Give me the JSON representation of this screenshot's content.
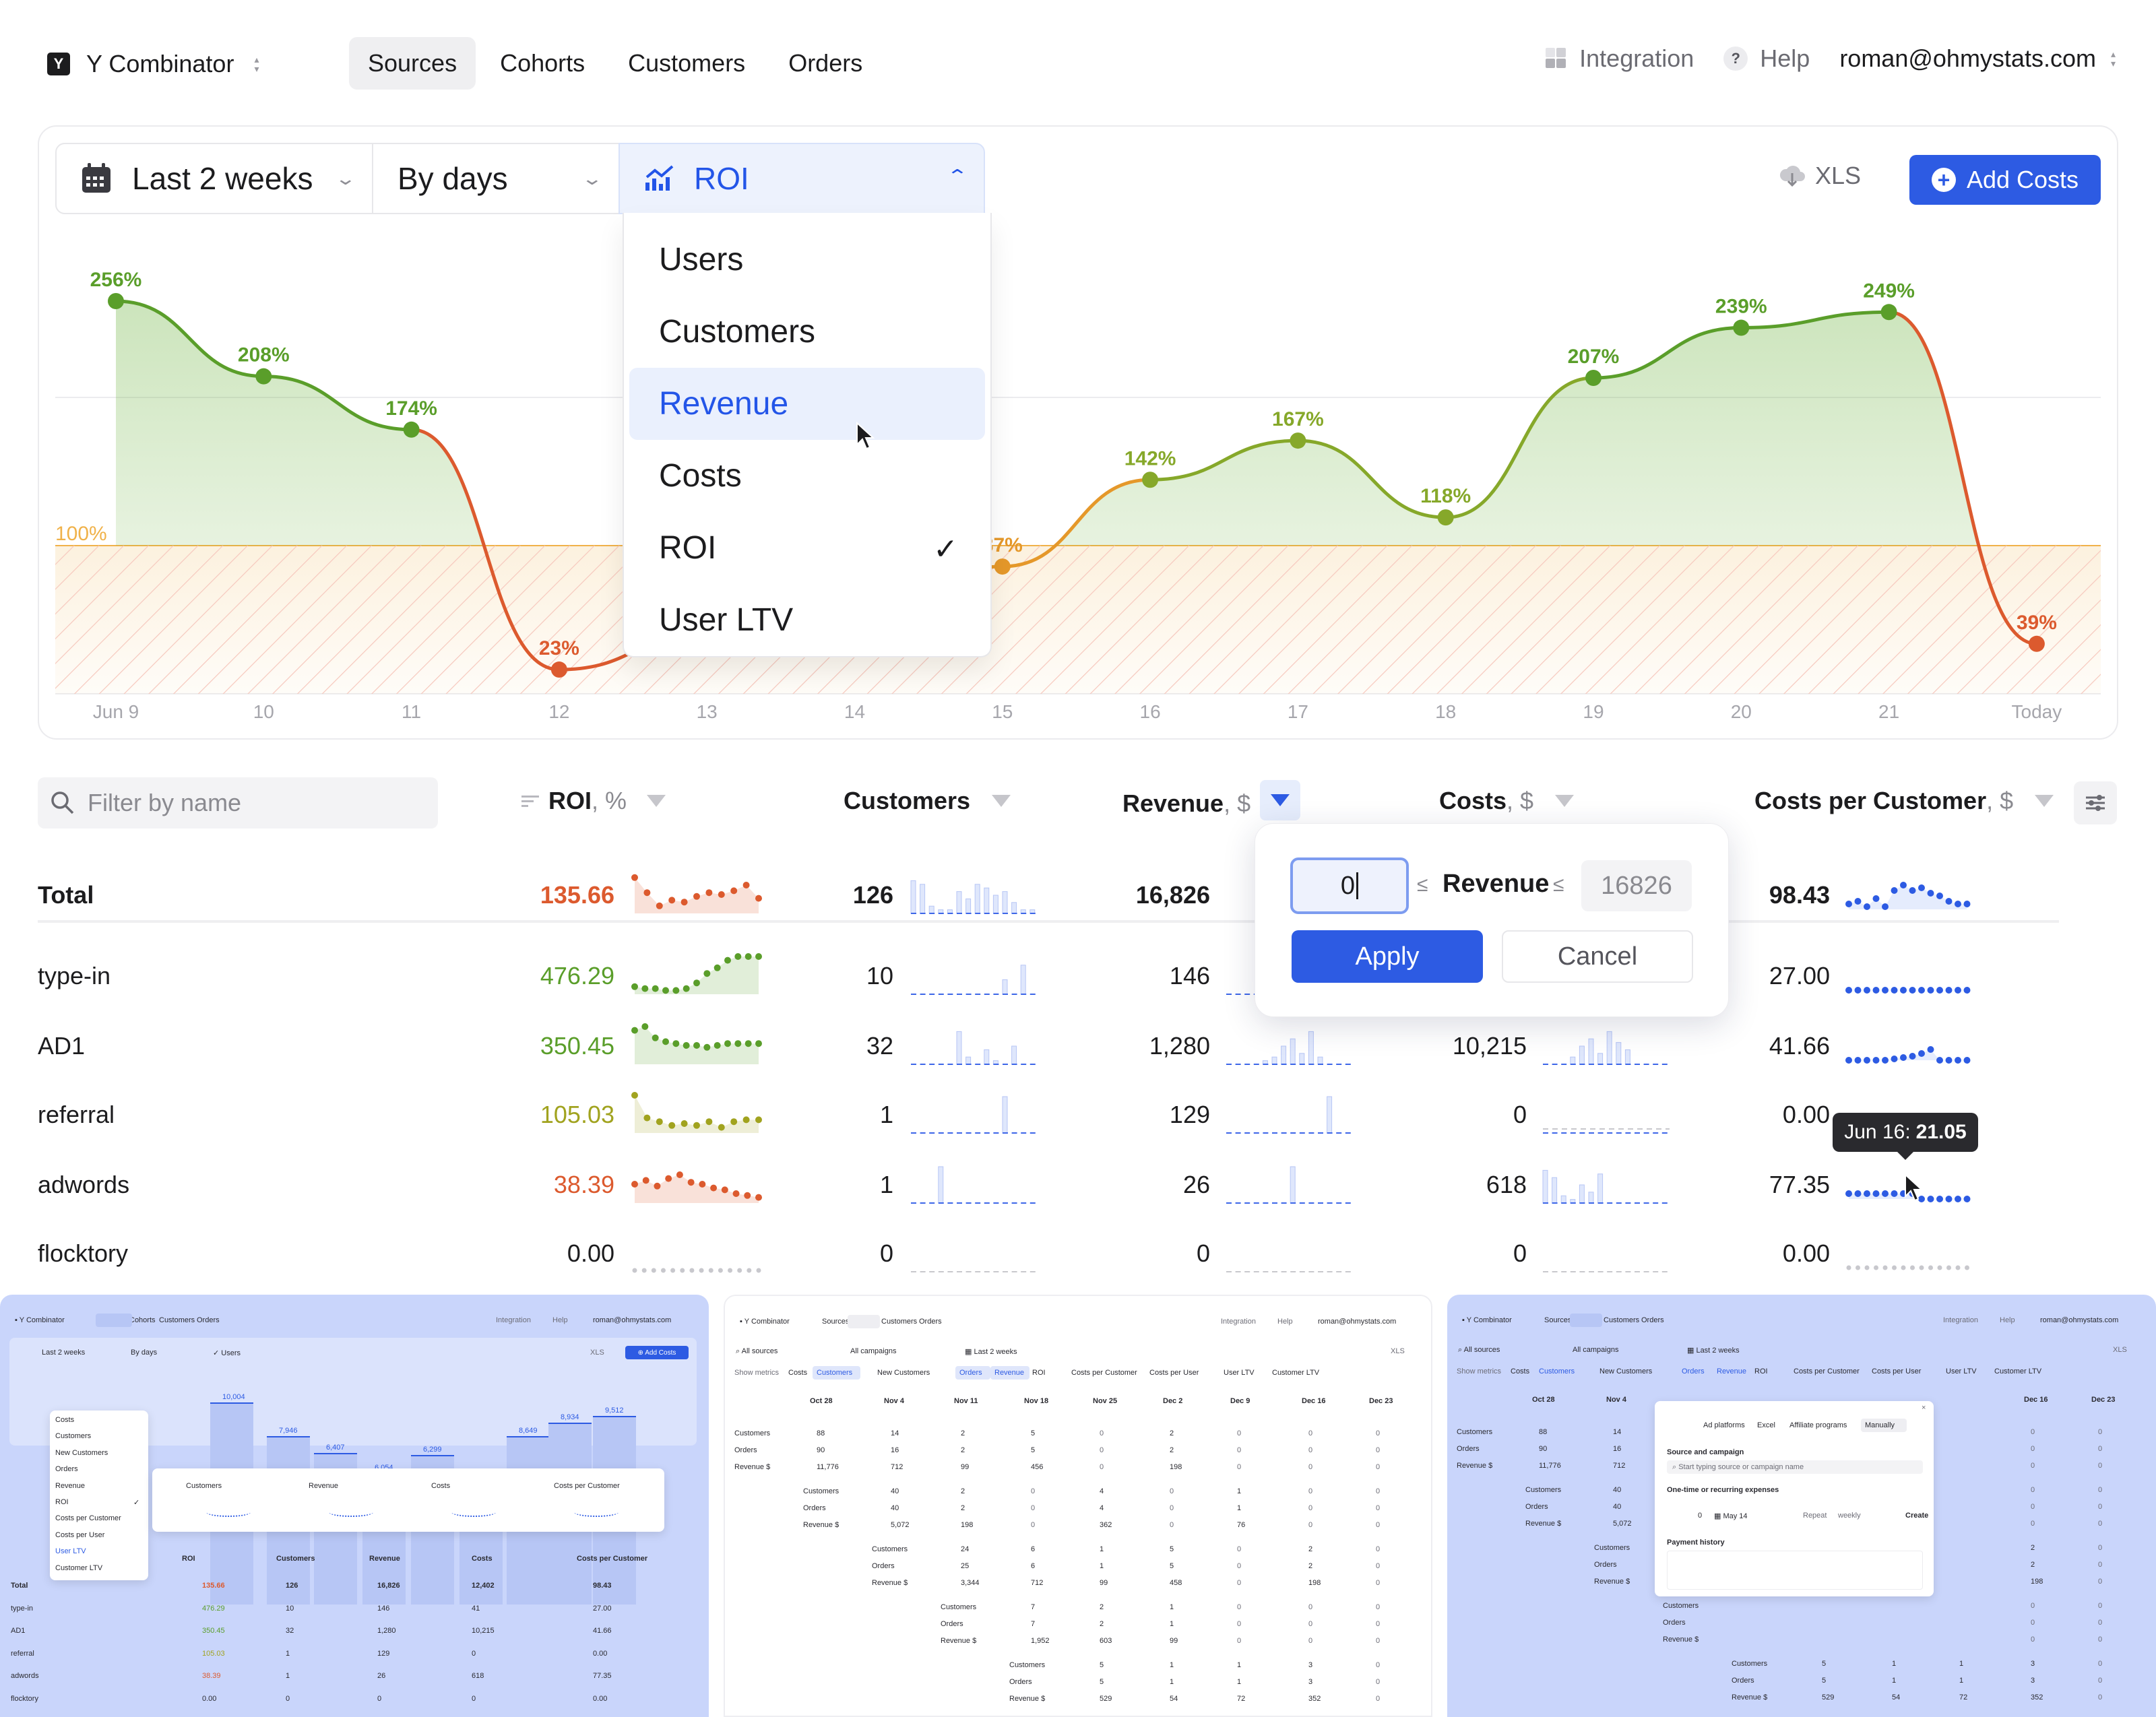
{
  "app": {
    "org_name": "Y Combinator",
    "logo_letter": "Y",
    "nav_tabs": [
      "Sources",
      "Cohorts",
      "Customers",
      "Orders"
    ],
    "active_tab": "Sources",
    "integration_label": "Integration",
    "help_label": "Help",
    "user_email": "roman@ohmystats.com"
  },
  "controls": {
    "period": "Last 2 weeks",
    "grouping": "By days",
    "metric": "ROI",
    "xls_label": "XLS",
    "add_costs_label": "Add Costs"
  },
  "metric_dropdown": {
    "options": [
      "Users",
      "Customers",
      "Revenue",
      "Costs",
      "ROI",
      "User LTV"
    ],
    "hovered": "Revenue",
    "selected": "ROI",
    "check_glyph": "✓"
  },
  "colors": {
    "accent": "#2d5be3",
    "green": "#5a9e2a",
    "olive": "#a1a31f",
    "orange": "#e5982a",
    "red": "#dc5a2e",
    "threshold": "#f0b24a"
  },
  "chart_data": {
    "type": "line",
    "x": [
      "Jun 9",
      "10",
      "11",
      "12",
      "13",
      "14",
      "15",
      "16",
      "17",
      "18",
      "19",
      "20",
      "21",
      "Today"
    ],
    "series": [
      {
        "values": [
          256,
          208,
          174,
          23,
          null,
          null,
          87,
          142,
          167,
          118,
          207,
          239,
          249,
          39
        ],
        "labels": [
          "256%",
          "208%",
          "174%",
          "23%",
          "",
          "",
          "87%",
          "142%",
          "167%",
          "118%",
          "207%",
          "239%",
          "249%",
          "39%"
        ]
      }
    ],
    "threshold": 100,
    "threshold_label": "100%",
    "ylim": [
      0,
      300
    ],
    "grid": true,
    "fill_below_threshold": "hatched"
  },
  "table": {
    "filter_placeholder": "Filter by name",
    "columns": [
      {
        "label": "ROI",
        "unit": ", %"
      },
      {
        "label": "Customers",
        "unit": ""
      },
      {
        "label": "Revenue",
        "unit": ", $"
      },
      {
        "label": "Costs",
        "unit": ", $"
      },
      {
        "label": "Costs per Customer",
        "unit": ", $"
      }
    ],
    "rows": [
      {
        "name": "Total",
        "roi": "135.66",
        "customers": "126",
        "revenue": "16,826",
        "costs": "",
        "cpc": "98.43",
        "roi_color": "red"
      },
      {
        "name": "type-in",
        "roi": "476.29",
        "customers": "10",
        "revenue": "146",
        "costs": "",
        "cpc": "27.00",
        "roi_color": "green"
      },
      {
        "name": "AD1",
        "roi": "350.45",
        "customers": "32",
        "revenue": "1,280",
        "costs": "10,215",
        "cpc": "41.66",
        "roi_color": "green"
      },
      {
        "name": "referral",
        "roi": "105.03",
        "customers": "1",
        "revenue": "129",
        "costs": "0",
        "cpc": "0.00",
        "roi_color": "olive"
      },
      {
        "name": "adwords",
        "roi": "38.39",
        "customers": "1",
        "revenue": "26",
        "costs": "618",
        "cpc": "77.35",
        "roi_color": "red"
      },
      {
        "name": "flocktory",
        "roi": "0.00",
        "customers": "0",
        "revenue": "0",
        "costs": "0",
        "cpc": "0.00",
        "roi_color": "gray"
      }
    ]
  },
  "revenue_filter": {
    "min_value": "0",
    "label": "Revenue",
    "le_glyph": "≤",
    "max_placeholder": "16826",
    "apply_label": "Apply",
    "cancel_label": "Cancel"
  },
  "tooltip": {
    "date": "Jun 16:",
    "value": "21.05"
  },
  "thumbnails": {
    "t1": {
      "brand": "Y Combinator",
      "tabs": [
        "Sources",
        "Cohorts",
        "Customers",
        "Orders"
      ],
      "right": [
        "Integration",
        "Help",
        "roman@ohmystats.com"
      ],
      "period": "Last 2 weeks",
      "grouping": "By days",
      "metric": "Users",
      "xls": "XLS",
      "add": "Add Costs",
      "menu": [
        "Costs",
        "Customers",
        "New Customers",
        "Orders",
        "Revenue",
        "ROI",
        "Costs per Customer",
        "Costs per User",
        "User LTV",
        "Customer LTV"
      ],
      "bar_labels": [
        "10,004",
        "7,946",
        "6,407",
        "6,054",
        "6,299",
        "5,338",
        "8,649",
        "8,934",
        "9,512"
      ],
      "cards": [
        "Customers",
        "Revenue",
        "Costs",
        "Costs per Customer"
      ],
      "headers": [
        "ROI",
        "Customers",
        "Revenue",
        "Costs",
        "Costs per Customer"
      ],
      "rows": [
        [
          "Total",
          "135.66",
          "126",
          "16,826",
          "12,402",
          "98.43"
        ],
        [
          "type-in",
          "476.29",
          "10",
          "146",
          "41",
          "27.00"
        ],
        [
          "AD1",
          "350.45",
          "32",
          "1,280",
          "10,215",
          "41.66"
        ],
        [
          "referral",
          "105.03",
          "1",
          "129",
          "0",
          "0.00"
        ],
        [
          "adwords",
          "38.39",
          "1",
          "26",
          "618",
          "77.35"
        ],
        [
          "flocktory",
          "0.00",
          "0",
          "0",
          "0",
          "0.00"
        ]
      ]
    },
    "t2": {
      "brand": "Y Combinator",
      "tabs": [
        "Sources",
        "Cohorts",
        "Customers",
        "Orders"
      ],
      "right": [
        "Integration",
        "Help",
        "roman@ohmystats.com"
      ],
      "filters": [
        "All sources",
        "All campaigns",
        "Last 2 weeks"
      ],
      "xls": "XLS",
      "show_metrics": "Show metrics",
      "metric_chips": [
        "Costs",
        "Customers",
        "New Customers",
        "Orders",
        "Revenue",
        "ROI",
        "Costs per Customer",
        "Costs per User",
        "User LTV",
        "Customer LTV"
      ],
      "dates": [
        "Oct 28",
        "Nov 4",
        "Nov 11",
        "Nov 18",
        "Nov 25",
        "Dec 2",
        "Dec 9",
        "Dec 16",
        "Dec 23"
      ],
      "blocks": [
        {
          "labels": [
            "Customers",
            "Orders",
            "Revenue"
          ],
          "values": [
            [
              "88",
              "14",
              "2",
              "5",
              "0",
              "2",
              "0",
              "0",
              "0"
            ],
            [
              "90",
              "16",
              "2",
              "5",
              "0",
              "2",
              "0",
              "0",
              "0"
            ],
            [
              "11,776",
              "712",
              "99",
              "456",
              "0",
              "198",
              "0",
              "0",
              "0"
            ]
          ]
        },
        {
          "labels": [
            "Customers",
            "Orders",
            "Revenue"
          ],
          "values": [
            [
              "40",
              "2",
              "0",
              "4",
              "0",
              "1",
              "0",
              "0"
            ],
            [
              "40",
              "2",
              "0",
              "4",
              "0",
              "1",
              "0",
              "0"
            ],
            [
              "5,072",
              "198",
              "0",
              "362",
              "0",
              "76",
              "0",
              "0"
            ]
          ]
        },
        {
          "labels": [
            "Customers",
            "Orders",
            "Revenue"
          ],
          "values": [
            [
              "24",
              "6",
              "1",
              "5",
              "0",
              "2",
              "0"
            ],
            [
              "25",
              "6",
              "1",
              "5",
              "0",
              "2",
              "0"
            ],
            [
              "3,344",
              "712",
              "99",
              "458",
              "0",
              "198",
              "0"
            ]
          ]
        },
        {
          "labels": [
            "Customers",
            "Orders",
            "Revenue"
          ],
          "values": [
            [
              "7",
              "2",
              "1",
              "0",
              "0",
              "0"
            ],
            [
              "7",
              "2",
              "1",
              "0",
              "0",
              "0"
            ],
            [
              "1,952",
              "603",
              "99",
              "0",
              "0",
              "0"
            ]
          ]
        },
        {
          "labels": [
            "Customers",
            "Orders",
            "Revenue"
          ],
          "values": [
            [
              "5",
              "1",
              "1",
              "3",
              "0"
            ],
            [
              "5",
              "1",
              "1",
              "3",
              "0"
            ],
            [
              "529",
              "54",
              "72",
              "352",
              "0"
            ]
          ]
        }
      ]
    },
    "t3": {
      "modal_tabs": [
        "Ad platforms",
        "Excel",
        "Affiliate programs",
        "Manually"
      ],
      "source_label": "Source and campaign",
      "source_placeholder": "Start typing source or campaign name",
      "expenses_label": "One-time or recurring expenses",
      "amount": "0",
      "date": "May 14",
      "repeat": "Repeat",
      "weekly": "weekly",
      "create": "Create",
      "history": "Payment history",
      "close": "×"
    }
  }
}
